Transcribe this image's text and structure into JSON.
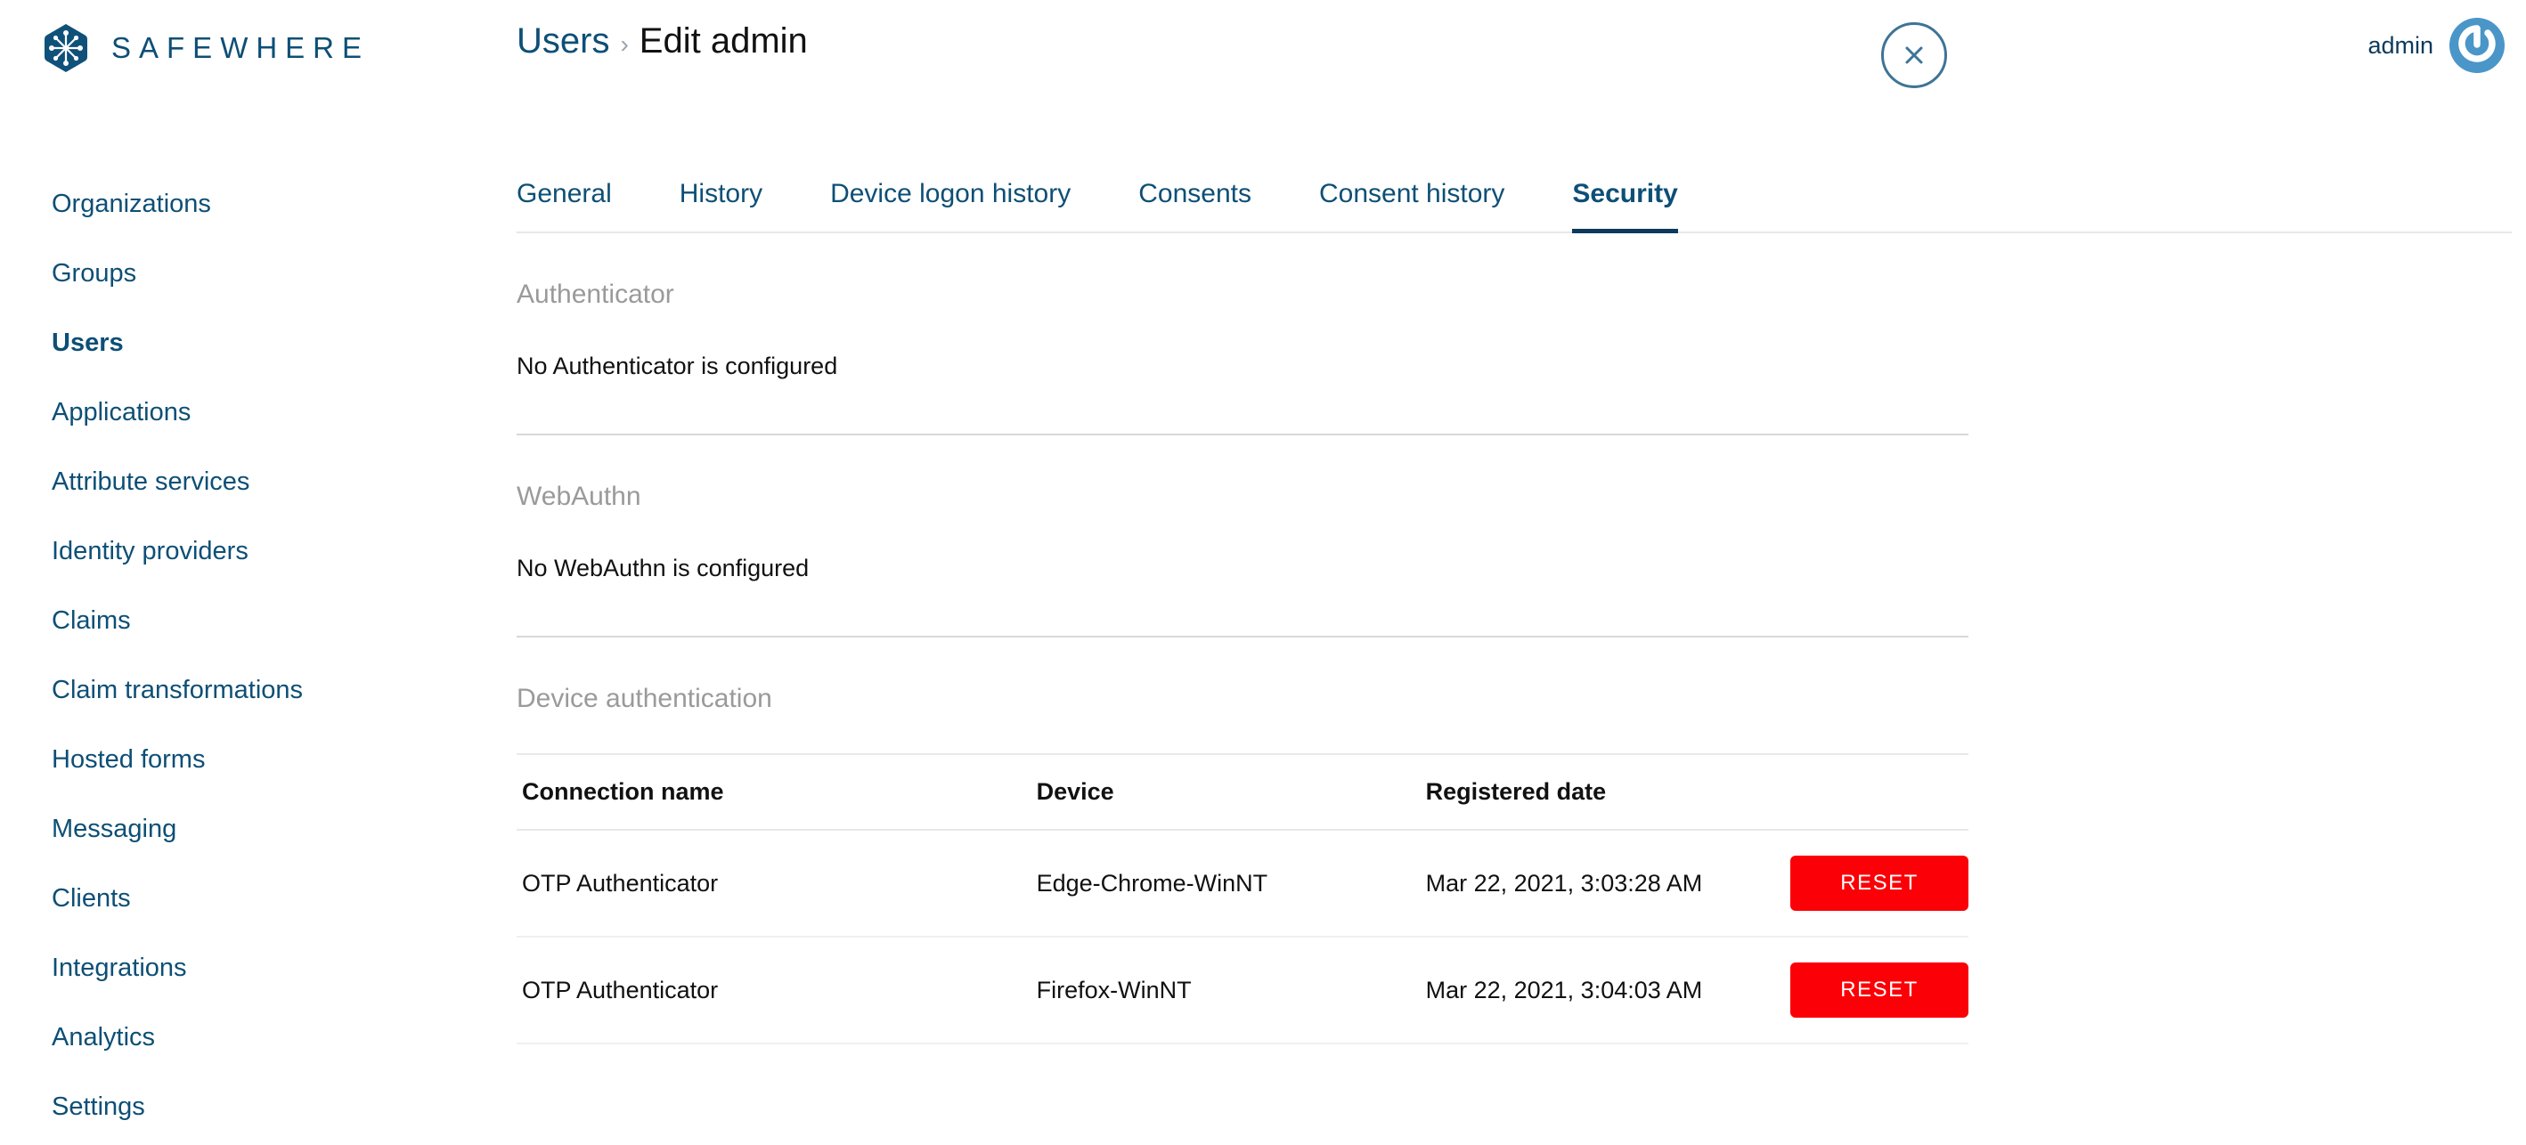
{
  "brand": {
    "wordmark": "SAFEWHERE",
    "logo_icon": "snowflake-hexagon-icon",
    "logo_color": "#0d4f76"
  },
  "header": {
    "breadcrumb": {
      "parent": "Users",
      "separator": "›",
      "current": "Edit admin"
    },
    "close_icon": "close-icon",
    "user": {
      "name": "admin",
      "avatar_icon": "power-avatar-icon",
      "avatar_color": "#4a96c8"
    }
  },
  "sidebar": {
    "items": [
      {
        "label": "Organizations",
        "active": false
      },
      {
        "label": "Groups",
        "active": false
      },
      {
        "label": "Users",
        "active": true
      },
      {
        "label": "Applications",
        "active": false
      },
      {
        "label": "Attribute services",
        "active": false
      },
      {
        "label": "Identity providers",
        "active": false
      },
      {
        "label": "Claims",
        "active": false
      },
      {
        "label": "Claim transformations",
        "active": false
      },
      {
        "label": "Hosted forms",
        "active": false
      },
      {
        "label": "Messaging",
        "active": false
      },
      {
        "label": "Clients",
        "active": false
      },
      {
        "label": "Integrations",
        "active": false
      },
      {
        "label": "Analytics",
        "active": false
      },
      {
        "label": "Settings",
        "active": false
      }
    ]
  },
  "tabs": [
    {
      "label": "General",
      "active": false
    },
    {
      "label": "History",
      "active": false
    },
    {
      "label": "Device logon history",
      "active": false
    },
    {
      "label": "Consents",
      "active": false
    },
    {
      "label": "Consent history",
      "active": false
    },
    {
      "label": "Security",
      "active": true
    }
  ],
  "sections": {
    "authenticator": {
      "title": "Authenticator",
      "message": "No Authenticator is configured"
    },
    "webauthn": {
      "title": "WebAuthn",
      "message": "No WebAuthn is configured"
    },
    "device_authentication": {
      "title": "Device authentication",
      "columns": {
        "connection_name": "Connection name",
        "device": "Device",
        "registered_date": "Registered date"
      },
      "rows": [
        {
          "connection_name": "OTP Authenticator",
          "device": "Edge-Chrome-WinNT",
          "registered_date": "Mar 22, 2021, 3:03:28 AM",
          "action_label": "RESET"
        },
        {
          "connection_name": "OTP Authenticator",
          "device": "Firefox-WinNT",
          "registered_date": "Mar 22, 2021, 3:04:03 AM",
          "action_label": "RESET"
        }
      ]
    }
  },
  "colors": {
    "brand_blue": "#0d4f76",
    "heading_gray": "#9a9a9a",
    "danger_red": "#fb0006",
    "active_tab": "#0d3a5c"
  }
}
